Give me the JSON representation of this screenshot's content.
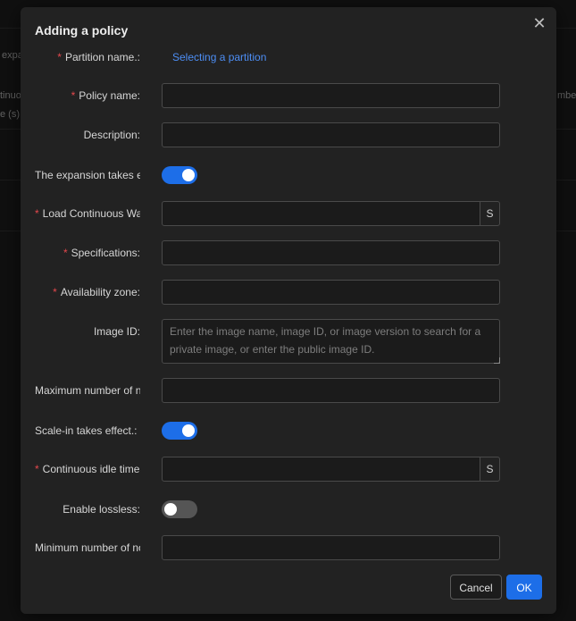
{
  "background": {
    "texts": [
      "expa",
      "tinuo",
      "e (s)",
      "mbe"
    ]
  },
  "dialog": {
    "title": "Adding a policy",
    "close_glyph": "✕",
    "fields": {
      "partition_label": "Partition name.:",
      "partition_link": "Selecting a partition",
      "policy_name_label": "Policy name:",
      "description_label": "Description:",
      "expansion_label": "The expansion takes effect",
      "expansion_on": true,
      "load_continuous_label": "Load Continuous Waiting Time",
      "load_continuous_suffix": "S",
      "specifications_label": "Specifications:",
      "availability_zone_label": "Availability zone:",
      "image_id_label": "Image ID:",
      "image_id_placeholder": "Enter the image name, image ID, or image version to search for a private image, or enter the public image ID.",
      "max_nodes_label": "Maximum number of nodes",
      "scale_in_label": "Scale-in takes effect.:",
      "scale_in_on": true,
      "idle_time_label": "Continuous idle time",
      "idle_time_suffix": "S",
      "lossless_label": "Enable lossless:",
      "lossless_on": false,
      "min_nodes_label": "Minimum number of nodes"
    },
    "required_mark": "*",
    "buttons": {
      "cancel": "Cancel",
      "ok": "OK"
    }
  },
  "colors": {
    "accent": "#1d6ee8",
    "link": "#4d8ef5",
    "required": "#e5484d"
  }
}
